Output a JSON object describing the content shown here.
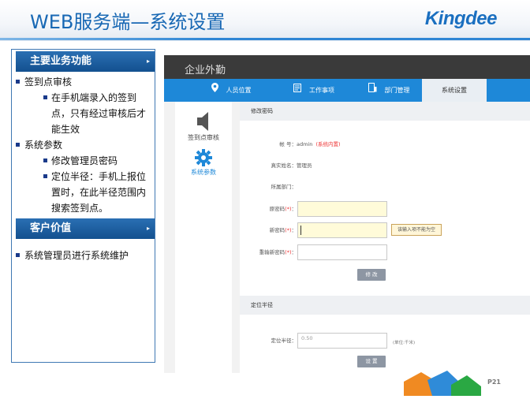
{
  "slide": {
    "title": "WEB服务端—系统设置",
    "logo": "Kingdee",
    "page": "P21"
  },
  "left_panel": {
    "section1": {
      "title": "主要业务功能",
      "arrow": "▸"
    },
    "items": [
      {
        "text": "签到点审核",
        "sub": [
          "在手机端录入的签到点，只有经过审核后才能生效"
        ]
      },
      {
        "text": "系统参数",
        "sub": [
          "修改管理员密码",
          "定位半径：手机上报位置时，在此半径范围内搜索签到点。"
        ]
      }
    ],
    "section2": {
      "title": "客户价值",
      "arrow": "▸"
    },
    "items2": [
      {
        "text": "系统管理员进行系统维护"
      }
    ]
  },
  "app": {
    "title": "企业外勤",
    "tabs": [
      {
        "label": "人员位置",
        "icon": "location-pin-icon"
      },
      {
        "label": "工作事项",
        "icon": "document-icon"
      },
      {
        "label": "部门管理",
        "icon": "org-icon"
      },
      {
        "label": "系统设置",
        "active": true
      }
    ],
    "sidebar": [
      {
        "label": "签到点审核",
        "icon": "speaker-icon"
      },
      {
        "label": "系统参数",
        "icon": "gear-icon",
        "active": true
      }
    ],
    "password_panel": {
      "heading": "修改密码",
      "account_label": "帐  号：",
      "account_value": "admin",
      "account_note": "(系统内置)",
      "name_label": "真实姓名：",
      "name_value": "管理员",
      "dept_label": "所属部门：",
      "orig_label": "原密码",
      "new_label": "新密码",
      "confirm_label": "重输新密码",
      "req_mark": "(*)",
      "colon": "：",
      "tooltip": "该输入项不能为空",
      "submit": "修 改"
    },
    "radius_panel": {
      "heading": "定位半径",
      "label": "定位半径：",
      "placeholder": "0.50",
      "unit": "(单位:千米)",
      "submit": "设 置"
    }
  },
  "colors": {
    "accent": "#1e88d8",
    "title": "#1868b4",
    "section": "#13508f"
  }
}
